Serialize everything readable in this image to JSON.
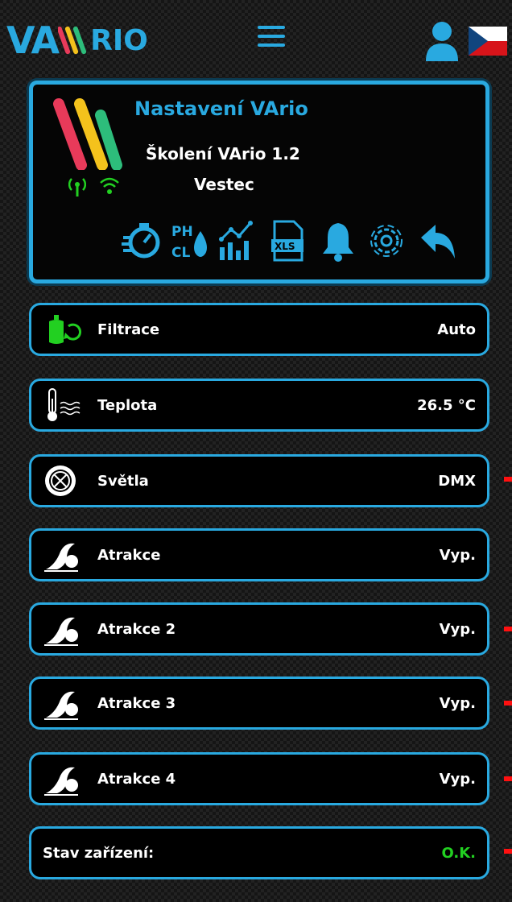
{
  "app": {
    "logo_text": "VA",
    "logo_rest": "RIO",
    "accent": "#29a9e0",
    "ok_color": "#22d021",
    "alert_color": "#ff1010"
  },
  "topbar": {
    "menu_icon": "hamburger-icon",
    "user_icon": "user-icon",
    "language_flag": "czech-flag-icon"
  },
  "header": {
    "title": "Nastavení VArio",
    "subtitle": "Školení VArio 1.2",
    "location": "Vestec",
    "signals": [
      "cellular-signal-icon",
      "wifi-signal-icon"
    ],
    "toolbar": [
      "dosing-timer-icon",
      "ph-cl-icon",
      "statistics-chart-icon",
      "xls-export-icon",
      "alarm-bell-icon",
      "settings-gear-icon",
      "back-arrow-icon"
    ]
  },
  "rows": [
    {
      "icon": "filtration-icon",
      "label": "Filtrace",
      "value": "Auto"
    },
    {
      "icon": "temperature-icon",
      "label": "Teplota",
      "value": "26.5 °C"
    },
    {
      "icon": "light-icon",
      "label": "Světla",
      "value": "DMX"
    },
    {
      "icon": "attraction-wave-icon",
      "label": "Atrakce",
      "value": "Vyp."
    },
    {
      "icon": "attraction-wave-icon",
      "label": "Atrakce 2",
      "value": "Vyp."
    },
    {
      "icon": "attraction-wave-icon",
      "label": "Atrakce 3",
      "value": "Vyp."
    },
    {
      "icon": "attraction-wave-icon",
      "label": "Atrakce 4",
      "value": "Vyp."
    }
  ],
  "status": {
    "label": "Stav zařízení:",
    "value": "O.K."
  }
}
